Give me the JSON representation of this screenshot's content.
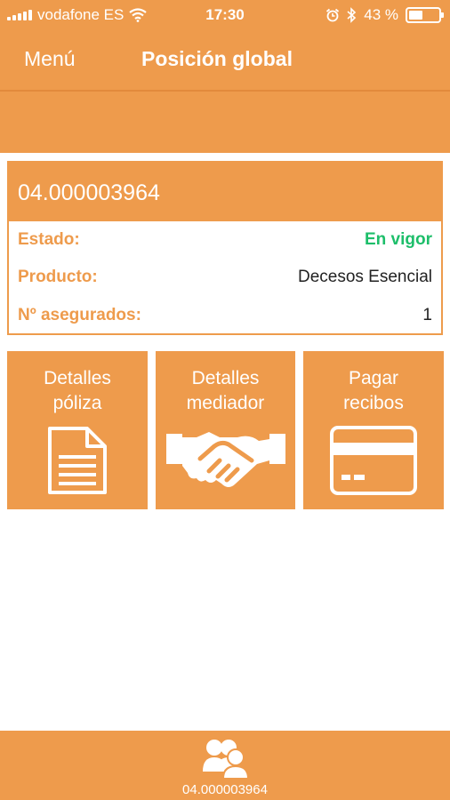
{
  "status_bar": {
    "carrier": "vodafone ES",
    "time": "17:30",
    "battery": "43 %"
  },
  "nav": {
    "menu_label": "Menú",
    "title": "Posición global"
  },
  "policy": {
    "number": "04.000003964",
    "fields": [
      {
        "label": "Estado:",
        "value": "En vigor"
      },
      {
        "label": "Producto:",
        "value": "Decesos Esencial"
      },
      {
        "label": "Nº asegurados:",
        "value": "1"
      }
    ]
  },
  "tiles": [
    {
      "line1": "Detalles",
      "line2": "póliza",
      "icon": "document-icon"
    },
    {
      "line1": "Detalles",
      "line2": "mediador",
      "icon": "handshake-icon"
    },
    {
      "line1": "Pagar",
      "line2": "recibos",
      "icon": "credit-card-icon"
    }
  ],
  "footer": {
    "label": "04.000003964",
    "icon": "users-icon"
  },
  "colors": {
    "brand_orange": "#EE9B4C",
    "status_green": "#1DBE6A"
  }
}
